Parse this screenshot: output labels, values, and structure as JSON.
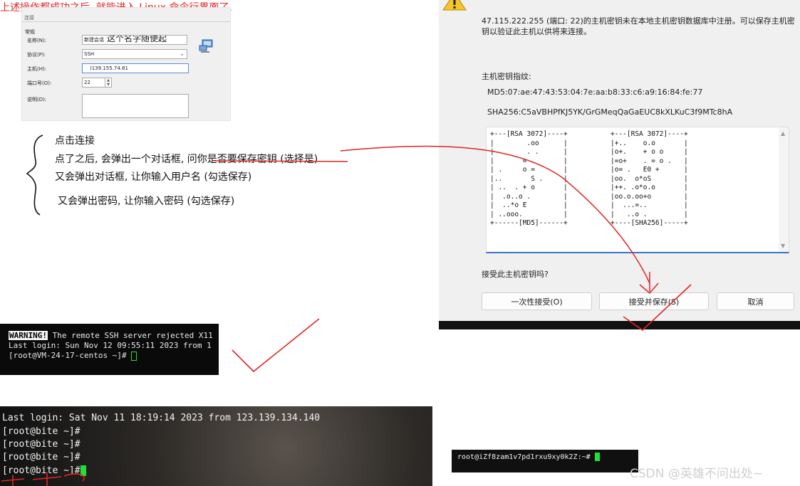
{
  "session_panel": {
    "section_label": "连接",
    "group_label": "常规",
    "labels": {
      "name": "名称(N):",
      "protocol": "协议(P):",
      "host": "主机(H):",
      "port": "端口号(O):",
      "description": "说明(D):"
    },
    "name_value": "新建会话",
    "name_note": "这个名字随便起",
    "protocol_value": "SSH",
    "host_value": ")139.155.74.81",
    "port_value": "22",
    "description_value": ""
  },
  "notes": {
    "lines": [
      "点击连接",
      "点了之后, 会弹出一个对话框, 问你是否要保存密钥 (选择是)",
      "又会弹出对话框, 让你输入用户名 (勾选保存)",
      "又会弹出密码, 让你输入密码 (勾选保存)"
    ],
    "summary": "上述操作都成功之后, 就能进入 Linux 命令行界面了."
  },
  "dialog": {
    "message": "47.115.222.255 (端口: 22)的主机密钥未在本地主机密钥数据库中注册。可以保存主机密钥以验证此主机以供将来连接。",
    "fingerprint_label": "主机密钥指纹:",
    "md5": "MD5:07:ae:47:43:53:04:7e:aa:b8:33:c6:a9:16:84:fe:77",
    "sha256": "SHA256:C5aVBHPfKJ5YK/GrGMeqQaGaEUC8kXLKuC3f9MTc8hA",
    "randomart_md5": "+---[RSA 3072]----+\n|        .oo      |\n|        . .      |\n|       = .       |\n| .     o =       |\n|..       S .     |\n| ..  . + o       |\n|  .o..o .        |\n|  ..*o E         |\n| ..ooo.          |\n+------[MD5]------+",
    "randomart_sha": "+---[RSA 3072]----+\n|+..    o.o       |\n|o+.    + o o     |\n|=o+    . = o .   |\n|o= .   E0 +      |\n|oo.  o*oS        |\n|++. .o*o.o       |\n|oo.o.oo+o        |\n|  ...=..         |\n|   ..o .         |\n+----[SHA256]-----+",
    "question": "接受此主机密钥吗?",
    "buttons": {
      "once": "一次性接受(O)",
      "save": "接受并保存(S)",
      "cancel": "取消"
    }
  },
  "terminal_a": {
    "warning_badge": "WARNING!",
    "warning_text": " The remote SSH server rejected X11",
    "last_login": "Last login: Sun Nov 12 09:55:11 2023 from 1",
    "prompt": "[root@VM-24-17-centos ~]# "
  },
  "terminal_b": {
    "last_login": "Last login: Sat Nov 11 18:19:14 2023 from 123.139.134.140",
    "prompts": [
      "[root@bite ~]#",
      "[root@bite ~]#",
      "[root@bite ~]#",
      "[root@bite ~]#"
    ]
  },
  "terminal_c": {
    "prompt": "root@iZf8zam1v7pd1rxu9xy0k2Z:~# "
  },
  "watermark": "CSDN @英雄不问出处~",
  "colors": {
    "annotation_red": "#e02424",
    "cursor_green": "#21e03b",
    "focus_blue": "#3b74c7"
  }
}
